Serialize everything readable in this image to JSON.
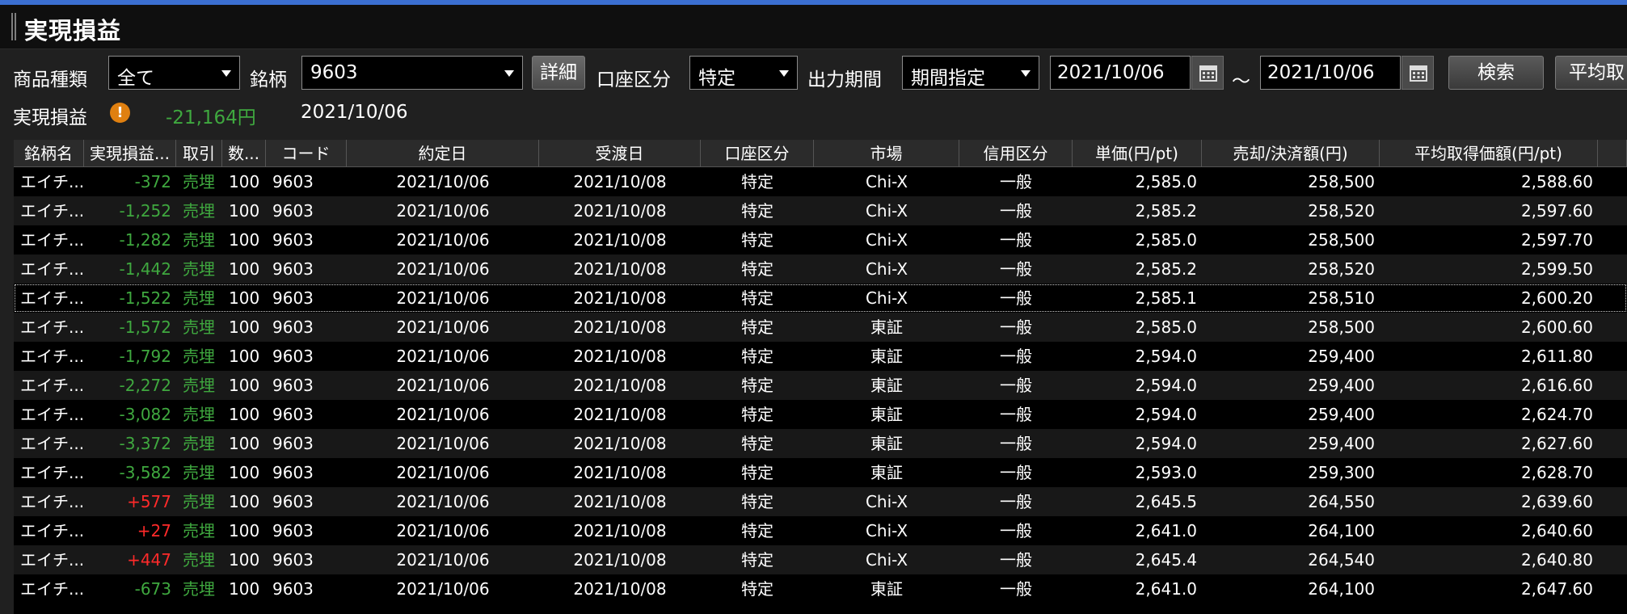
{
  "window": {
    "title": "実現損益"
  },
  "filters": {
    "product_type_label": "商品種類",
    "product_type_value": "全て",
    "symbol_label": "銘柄",
    "symbol_value": "9603",
    "detail_button": "詳細",
    "account_type_label": "口座区分",
    "account_type_value": "特定",
    "period_label": "出力期間",
    "period_value": "期間指定",
    "date_from": "2021/10/06",
    "tilde": "～",
    "date_to": "2021/10/06",
    "search_button": "検索",
    "average_button": "平均取"
  },
  "summary": {
    "label": "実現損益",
    "warning_icon": "!",
    "total": "-21,164円",
    "date": "2021/10/06"
  },
  "colors": {
    "negative": "#3fa83f",
    "positive": "#ff2a2a",
    "trade": "#3fa83f",
    "accent": "#3b6fd1"
  },
  "table": {
    "columns": [
      "銘柄名",
      "実現損益...",
      "取引",
      "数...",
      "コード",
      "約定日",
      "受渡日",
      "口座区分",
      "市場",
      "信用区分",
      "単価(円/pt)",
      "売却/決済額(円)",
      "平均取得価額(円/pt)"
    ],
    "rows": [
      {
        "name": "エイチ...",
        "pl": "-372",
        "sign": "neg",
        "trade": "売埋",
        "qty": "100",
        "code": "9603",
        "exec": "2021/10/06",
        "settle": "2021/10/08",
        "account": "特定",
        "market": "Chi-X",
        "credit": "一般",
        "price": "2,585.0",
        "amount": "258,500",
        "avg": "2,588.60"
      },
      {
        "name": "エイチ...",
        "pl": "-1,252",
        "sign": "neg",
        "trade": "売埋",
        "qty": "100",
        "code": "9603",
        "exec": "2021/10/06",
        "settle": "2021/10/08",
        "account": "特定",
        "market": "Chi-X",
        "credit": "一般",
        "price": "2,585.2",
        "amount": "258,520",
        "avg": "2,597.60"
      },
      {
        "name": "エイチ...",
        "pl": "-1,282",
        "sign": "neg",
        "trade": "売埋",
        "qty": "100",
        "code": "9603",
        "exec": "2021/10/06",
        "settle": "2021/10/08",
        "account": "特定",
        "market": "Chi-X",
        "credit": "一般",
        "price": "2,585.0",
        "amount": "258,500",
        "avg": "2,597.70"
      },
      {
        "name": "エイチ...",
        "pl": "-1,442",
        "sign": "neg",
        "trade": "売埋",
        "qty": "100",
        "code": "9603",
        "exec": "2021/10/06",
        "settle": "2021/10/08",
        "account": "特定",
        "market": "Chi-X",
        "credit": "一般",
        "price": "2,585.2",
        "amount": "258,520",
        "avg": "2,599.50"
      },
      {
        "name": "エイチ...",
        "pl": "-1,522",
        "sign": "neg",
        "trade": "売埋",
        "qty": "100",
        "code": "9603",
        "exec": "2021/10/06",
        "settle": "2021/10/08",
        "account": "特定",
        "market": "Chi-X",
        "credit": "一般",
        "price": "2,585.1",
        "amount": "258,510",
        "avg": "2,600.20",
        "selected": true
      },
      {
        "name": "エイチ...",
        "pl": "-1,572",
        "sign": "neg",
        "trade": "売埋",
        "qty": "100",
        "code": "9603",
        "exec": "2021/10/06",
        "settle": "2021/10/08",
        "account": "特定",
        "market": "東証",
        "credit": "一般",
        "price": "2,585.0",
        "amount": "258,500",
        "avg": "2,600.60"
      },
      {
        "name": "エイチ...",
        "pl": "-1,792",
        "sign": "neg",
        "trade": "売埋",
        "qty": "100",
        "code": "9603",
        "exec": "2021/10/06",
        "settle": "2021/10/08",
        "account": "特定",
        "market": "東証",
        "credit": "一般",
        "price": "2,594.0",
        "amount": "259,400",
        "avg": "2,611.80"
      },
      {
        "name": "エイチ...",
        "pl": "-2,272",
        "sign": "neg",
        "trade": "売埋",
        "qty": "100",
        "code": "9603",
        "exec": "2021/10/06",
        "settle": "2021/10/08",
        "account": "特定",
        "market": "東証",
        "credit": "一般",
        "price": "2,594.0",
        "amount": "259,400",
        "avg": "2,616.60"
      },
      {
        "name": "エイチ...",
        "pl": "-3,082",
        "sign": "neg",
        "trade": "売埋",
        "qty": "100",
        "code": "9603",
        "exec": "2021/10/06",
        "settle": "2021/10/08",
        "account": "特定",
        "market": "東証",
        "credit": "一般",
        "price": "2,594.0",
        "amount": "259,400",
        "avg": "2,624.70"
      },
      {
        "name": "エイチ...",
        "pl": "-3,372",
        "sign": "neg",
        "trade": "売埋",
        "qty": "100",
        "code": "9603",
        "exec": "2021/10/06",
        "settle": "2021/10/08",
        "account": "特定",
        "market": "東証",
        "credit": "一般",
        "price": "2,594.0",
        "amount": "259,400",
        "avg": "2,627.60"
      },
      {
        "name": "エイチ...",
        "pl": "-3,582",
        "sign": "neg",
        "trade": "売埋",
        "qty": "100",
        "code": "9603",
        "exec": "2021/10/06",
        "settle": "2021/10/08",
        "account": "特定",
        "market": "東証",
        "credit": "一般",
        "price": "2,593.0",
        "amount": "259,300",
        "avg": "2,628.70"
      },
      {
        "name": "エイチ...",
        "pl": "+577",
        "sign": "pos",
        "trade": "売埋",
        "qty": "100",
        "code": "9603",
        "exec": "2021/10/06",
        "settle": "2021/10/08",
        "account": "特定",
        "market": "Chi-X",
        "credit": "一般",
        "price": "2,645.5",
        "amount": "264,550",
        "avg": "2,639.60"
      },
      {
        "name": "エイチ...",
        "pl": "+27",
        "sign": "pos",
        "trade": "売埋",
        "qty": "100",
        "code": "9603",
        "exec": "2021/10/06",
        "settle": "2021/10/08",
        "account": "特定",
        "market": "Chi-X",
        "credit": "一般",
        "price": "2,641.0",
        "amount": "264,100",
        "avg": "2,640.60"
      },
      {
        "name": "エイチ...",
        "pl": "+447",
        "sign": "pos",
        "trade": "売埋",
        "qty": "100",
        "code": "9603",
        "exec": "2021/10/06",
        "settle": "2021/10/08",
        "account": "特定",
        "market": "Chi-X",
        "credit": "一般",
        "price": "2,645.4",
        "amount": "264,540",
        "avg": "2,640.80"
      },
      {
        "name": "エイチ...",
        "pl": "-673",
        "sign": "neg",
        "trade": "売埋",
        "qty": "100",
        "code": "9603",
        "exec": "2021/10/06",
        "settle": "2021/10/08",
        "account": "特定",
        "market": "東証",
        "credit": "一般",
        "price": "2,641.0",
        "amount": "264,100",
        "avg": "2,647.60"
      }
    ]
  }
}
